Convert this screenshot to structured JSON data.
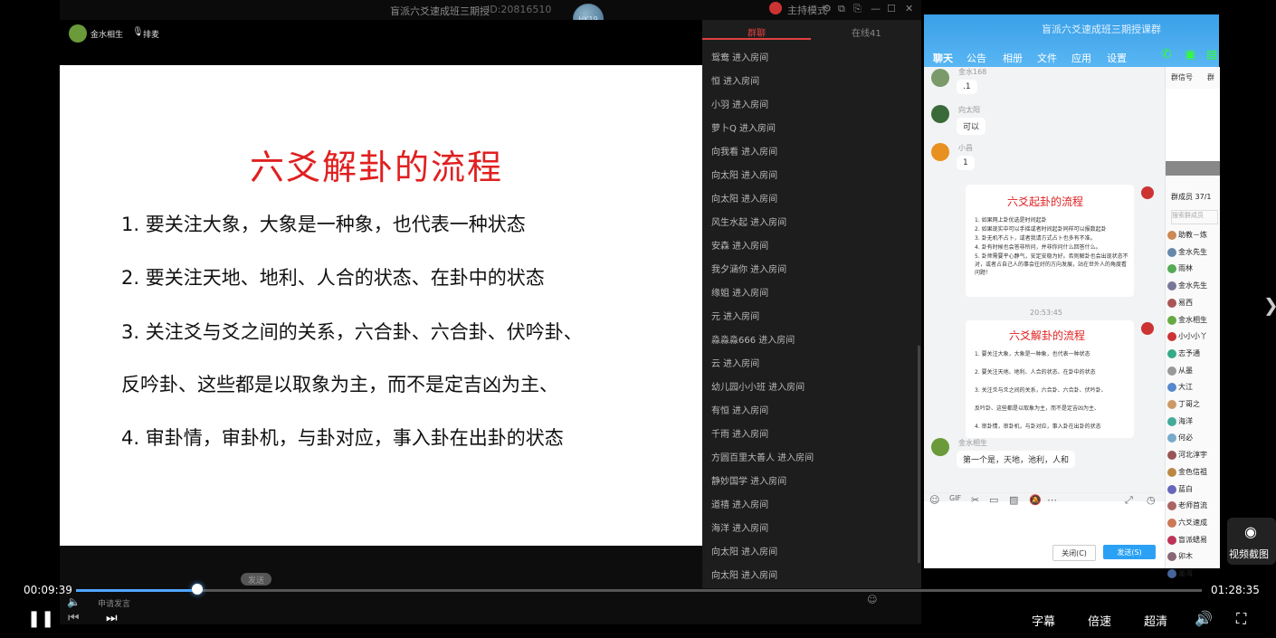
{
  "live": {
    "title": "盲派六爻速成班三期授",
    "room_id": "ID:20816510",
    "logo_text": "HK19",
    "host_mode": "主持模式",
    "teacher_name": "金水相生",
    "rank_label": "排麦",
    "chat_tabs": [
      "群聊",
      "在线41"
    ],
    "chat_placeholder": "申请发言",
    "send_label": "发送",
    "enter_rows": [
      "鸳鸯 进入房间",
      "恒 进入房间",
      "小羽 进入房间",
      "萝卜Q 进入房间",
      "向我看 进入房间",
      "向太阳 进入房间",
      "向太阳 进入房间",
      "风生水起 进入房间",
      "安森 进入房间",
      "我夕涵你 进入房间",
      "缘姐 进入房间",
      "元 进入房间",
      "淼淼淼666 进入房间",
      "云 进入房间",
      "幼儿园小小班 进入房间",
      "有恒 进入房间",
      "千雨 进入房间",
      "方圆百里大善人 进入房间",
      "静妙国学 进入房间",
      "道禧 进入房间",
      "海洋 进入房间",
      "向太阳 进入房间",
      "向太阳 进入房间"
    ]
  },
  "slide": {
    "title": "六爻解卦的流程",
    "lines": [
      "1. 要关注大象，大象是一种象，也代表一种状态",
      "2. 要关注天地、地利、人合的状态、在卦中的状态",
      "3. 关注爻与爻之间的关系，六合卦、六合卦、伏吟卦、",
      "反吟卦、这些都是以取象为主，而不是定吉凶为主、",
      "4. 审卦情，审卦机，与卦对应，事入卦在出卦的状态"
    ]
  },
  "qq": {
    "title": "盲派六爻速成班三期授课群",
    "tabs": [
      "聊天",
      "公告",
      "相册",
      "文件",
      "应用",
      "设置"
    ],
    "side_tabs": [
      "群信号",
      "群"
    ],
    "member_count": "群成员 37/1",
    "member_search": "搜索群成员",
    "messages": [
      {
        "name": "金水168",
        "text": ".1"
      },
      {
        "name": "向太阳",
        "text": "可以"
      },
      {
        "name": "小昌",
        "text": "1"
      }
    ],
    "card1": {
      "title": "六爻起卦的流程",
      "lines": [
        "1. 如果网上卦优选是时间起卦",
        "2. 如果现实中可以手摇或者时间起卦同样可以报数起卦",
        "3. 卦无机不占卜，或者我请方式占卜也多有不准。",
        "4. 卦有时候也会答非所问，并非你问什么回答什么。",
        "5. 卦师需要平心静气，安定安稳为好。否则解卦也会出现状态不对，或者占自己人的事会往好的方向发展，站在世外人的角度看问题！"
      ]
    },
    "time": "20:53:45",
    "card2": {
      "title": "六爻解卦的流程",
      "lines": [
        "1. 要关注大象，大象是一种象，也代表一种状态",
        "2. 要关注天地、地利、人合的状态、在卦中的状态",
        "3. 关注爻与爻之间的关系，六合卦、六合卦、伏吟卦、",
        "反吟卦、这些都是以取象为主，而不是定吉凶为主、",
        "4. 审卦情，审卦机，与卦对应，事入卦在出卦的状态"
      ]
    },
    "last_msg": {
      "name": "金水相生",
      "text": "第一个是，天地，池利，人和"
    },
    "close_label": "关闭(C)",
    "send_label": "发送(S)",
    "members": [
      "助教－炼",
      "金水先生",
      "雨林",
      "金水先生",
      "易西",
      "金水相生",
      "小小小丫",
      "志予通",
      "从墨",
      "大江",
      "丁哥之",
      "海洋",
      "何必",
      "河北淳宇",
      "金色信祖",
      "蓝白",
      "老师首流",
      "六爻速成",
      "盲派蟋易",
      "卯木",
      "墨海"
    ]
  },
  "player": {
    "current_time": "00:09:39",
    "total_time": "01:28:35",
    "progress": 0.108,
    "subtitle_label": "字幕",
    "speed_label": "倍速",
    "quality_label": "超清",
    "screenshot_label": "视频截图"
  }
}
